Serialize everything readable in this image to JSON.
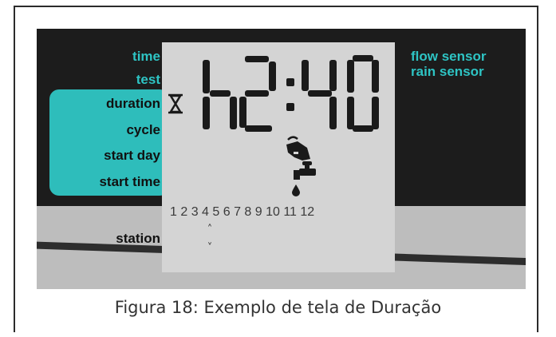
{
  "left_labels": {
    "time": "time",
    "test": "test",
    "duration": "duration",
    "cycle": "cycle",
    "start_day": "start day",
    "start_time": "start time",
    "station": "station"
  },
  "right_labels": {
    "flow_sensor": "flow sensor",
    "rain_sensor": "rain sensor"
  },
  "lcd": {
    "display_value": "h2:40",
    "station_numbers": "1 2 3 4 5 6 7 8 9 10 11 12",
    "up_arrow": "˄",
    "down_arrow": "˅"
  },
  "caption": "Figura 18: Exemplo de tela de Duração",
  "colors": {
    "accent_teal": "#2ebdbb",
    "label_cyan": "#2ec4c4",
    "lcd_background": "#d4d4d4",
    "lcd_segment": "#1a1a1a"
  },
  "icons": [
    "hourglass-icon",
    "hand-pointer-icon",
    "faucet-icon",
    "water-drop-icon"
  ]
}
